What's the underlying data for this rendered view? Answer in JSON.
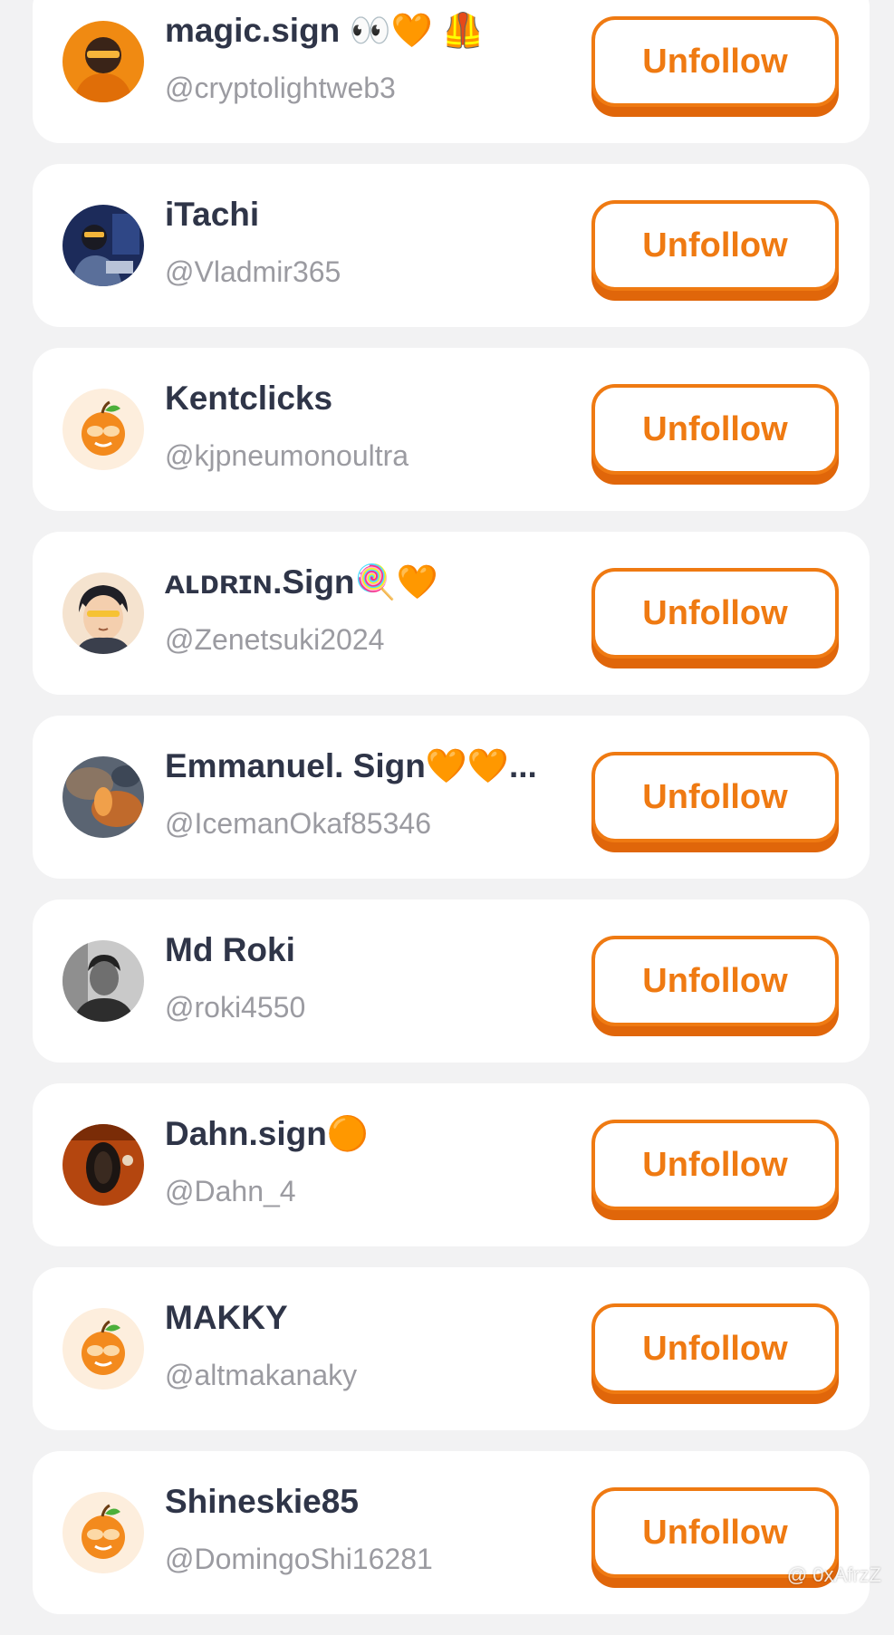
{
  "button_label": "Unfollow",
  "accent_color": "#ef7a12",
  "watermark": "@ 0xAfrzZ",
  "following": [
    {
      "name": "magic.sign 👀🧡 🦺",
      "handle": "@cryptolightweb3",
      "avatar_icon": "hooded-figure-avatar"
    },
    {
      "name": "iTachi",
      "handle": "@Vladmir365",
      "avatar_icon": "person-at-desk-avatar"
    },
    {
      "name": "Kentclicks",
      "handle": "@kjpneumonoultra",
      "avatar_icon": "orange-mascot-avatar"
    },
    {
      "name": "ᴀʟᴅʀɪɴ.Sign🍭🧡",
      "handle": "@Zenetsuki2024",
      "avatar_icon": "anime-face-avatar"
    },
    {
      "name": "Emmanuel. Sign🧡🧡...",
      "handle": "@IcemanOkaf85346",
      "avatar_icon": "blurred-photo-avatar"
    },
    {
      "name": "Md Roki",
      "handle": "@roki4550",
      "avatar_icon": "grayscale-portrait-avatar"
    },
    {
      "name": "Dahn.sign🟠",
      "handle": "@Dahn_4",
      "avatar_icon": "dark-leaf-avatar"
    },
    {
      "name": "MAKKY",
      "handle": "@altmakanaky",
      "avatar_icon": "orange-mascot-avatar"
    },
    {
      "name": "Shineskie85",
      "handle": "@DomingoShi16281",
      "avatar_icon": "orange-mascot-avatar"
    }
  ]
}
